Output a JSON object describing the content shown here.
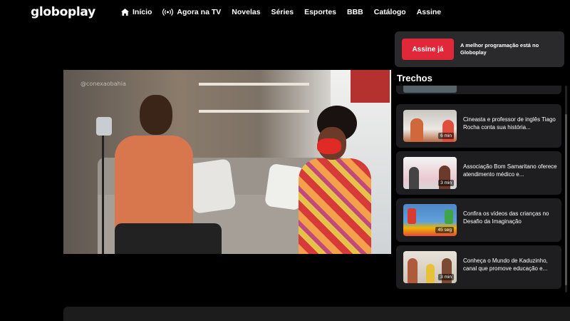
{
  "header": {
    "logo": "globoplay",
    "nav": [
      {
        "label": "Início",
        "icon": "home-icon"
      },
      {
        "label": "Agora na TV",
        "icon": "broadcast-icon"
      },
      {
        "label": "Novelas"
      },
      {
        "label": "Séries"
      },
      {
        "label": "Esportes"
      },
      {
        "label": "BBB"
      },
      {
        "label": "Catálogo"
      },
      {
        "label": "Assine"
      }
    ]
  },
  "video": {
    "watermark": "@conexaobahia"
  },
  "subscribe": {
    "button_label": "Assine já",
    "text": "A melhor programação está no Globoplay"
  },
  "trechos": {
    "title": "Trechos",
    "items": [
      {
        "title": "Cineasta e professor de inglês Tiago Rocha conta sua história...",
        "duration": "6 min"
      },
      {
        "title": "Associação Bom Samaritano oferece atendimento médico e...",
        "duration": "3 min"
      },
      {
        "title": "Confira os vídeos das crianças no Desafio da Imaginação",
        "duration": "45 seg"
      },
      {
        "title": "Conheça o Mundo de Kaduzinho, canal que promove educação e...",
        "duration": "3 min"
      }
    ]
  },
  "colors": {
    "accent": "#e0283a",
    "background": "#000000",
    "card": "#1e1e20"
  }
}
